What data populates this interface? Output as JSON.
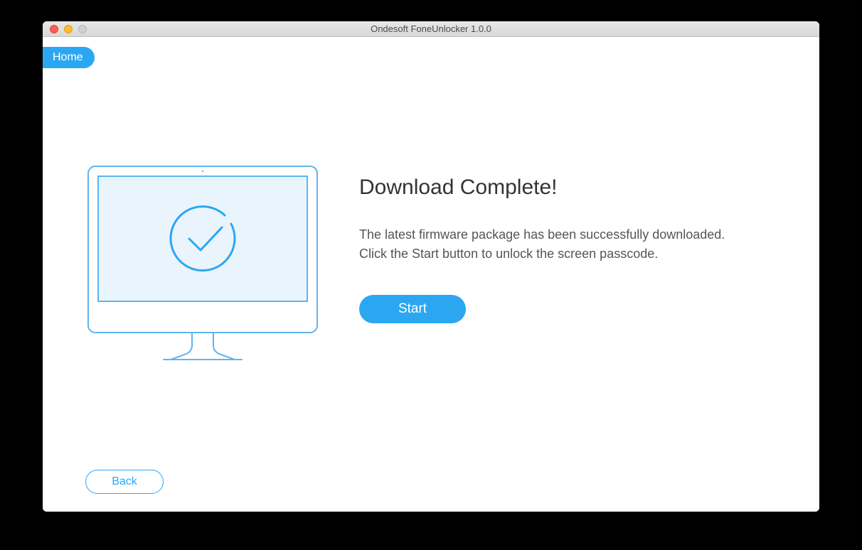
{
  "window": {
    "title": "Ondesoft FoneUnlocker 1.0.0"
  },
  "nav": {
    "home_label": "Home"
  },
  "main": {
    "heading": "Download Complete!",
    "description_line1": "The latest firmware package has been successfully downloaded.",
    "description_line2": "Click the Start button to unlock the screen passcode.",
    "start_label": "Start",
    "back_label": "Back"
  }
}
